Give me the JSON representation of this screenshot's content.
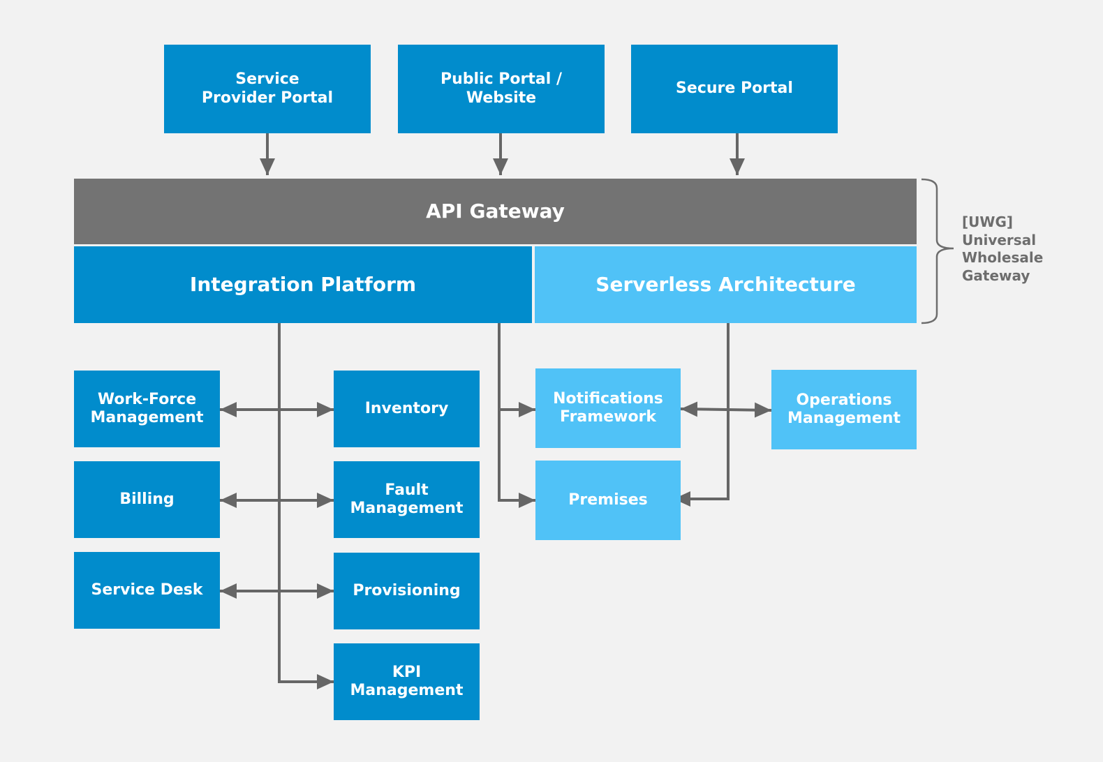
{
  "colors": {
    "dark_blue": "#018ccc",
    "light_blue": "#50c2f7",
    "gateway_grey": "#737373",
    "connector_grey": "#666666",
    "background": "#f2f2f2"
  },
  "portals": [
    {
      "id": "service-provider-portal",
      "label": "Service\nProvider Portal"
    },
    {
      "id": "public-portal-website",
      "label": "Public Portal /\nWebsite"
    },
    {
      "id": "secure-portal",
      "label": "Secure Portal"
    }
  ],
  "gateway": {
    "api_gateway": "API Gateway",
    "integration_platform": "Integration Platform",
    "serverless_architecture": "Serverless Architecture"
  },
  "uwg_group": {
    "label": "[UWG]\nUniversal\nWholesale\nGateway"
  },
  "integration_modules": [
    {
      "id": "work-force-management",
      "label": "Work-Force\nManagement"
    },
    {
      "id": "inventory",
      "label": "Inventory"
    },
    {
      "id": "billing",
      "label": "Billing"
    },
    {
      "id": "fault-management",
      "label": "Fault\nManagement"
    },
    {
      "id": "service-desk",
      "label": "Service Desk"
    },
    {
      "id": "provisioning",
      "label": "Provisioning"
    },
    {
      "id": "kpi-management",
      "label": "KPI\nManagement"
    }
  ],
  "serverless_modules": [
    {
      "id": "notifications-framework",
      "label": "Notifications\nFramework"
    },
    {
      "id": "operations-management",
      "label": "Operations\nManagement"
    },
    {
      "id": "premises",
      "label": "Premises"
    }
  ],
  "connections": [
    {
      "from": "Service Provider Portal",
      "to": "API Gateway",
      "direction": "one-way"
    },
    {
      "from": "Public Portal / Website",
      "to": "API Gateway",
      "direction": "one-way"
    },
    {
      "from": "Secure Portal",
      "to": "API Gateway",
      "direction": "one-way"
    },
    {
      "from": "Integration Platform",
      "to": [
        "Work-Force Management",
        "Inventory"
      ],
      "direction": "two-way"
    },
    {
      "from": "Integration Platform",
      "to": [
        "Billing",
        "Fault Management"
      ],
      "direction": "two-way"
    },
    {
      "from": "Integration Platform",
      "to": [
        "Service Desk",
        "Provisioning"
      ],
      "direction": "two-way"
    },
    {
      "from": "Integration Platform",
      "to": "KPI Management",
      "direction": "one-way"
    },
    {
      "from": "Integration Platform",
      "to": "Notifications Framework",
      "direction": "one-way"
    },
    {
      "from": "Integration Platform",
      "to": "Premises",
      "direction": "one-way"
    },
    {
      "from": "Serverless Architecture",
      "to": [
        "Notifications Framework",
        "Operations Management"
      ],
      "direction": "two-way"
    },
    {
      "from": "Serverless Architecture",
      "to": "Premises",
      "direction": "one-way"
    }
  ]
}
